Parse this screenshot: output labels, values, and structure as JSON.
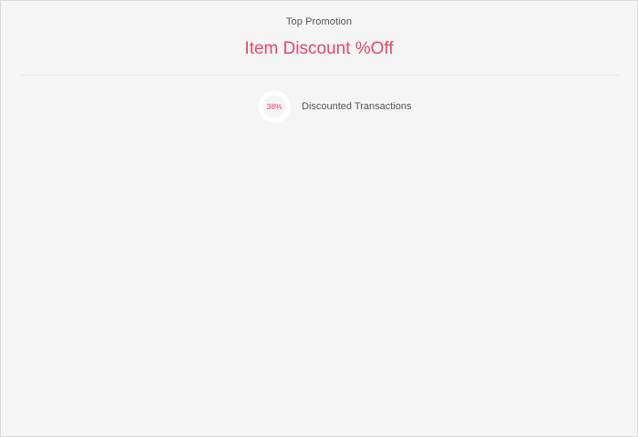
{
  "header": {
    "subtitle": "Top Promotion",
    "title": "Item Discount %Off"
  },
  "metric": {
    "value_label": "38%",
    "value_fraction": 0.38,
    "label": "Discounted Transactions"
  },
  "colors": {
    "accent": "#e8476b",
    "ring_track": "#ffffff",
    "background": "#f5f5f5",
    "text": "#555555"
  }
}
